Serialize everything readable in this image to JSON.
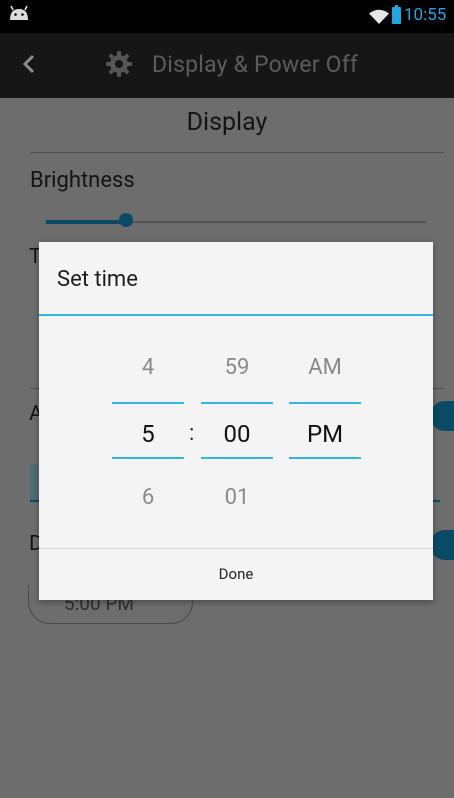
{
  "status_bar": {
    "time": "10:55",
    "icons": [
      "android-icon",
      "wifi-icon",
      "battery-icon"
    ],
    "accent_color": "#1ea7e1"
  },
  "action_bar": {
    "title": "Display & Power Off",
    "icons": [
      "back-chevron-icon",
      "gear-icon"
    ]
  },
  "background": {
    "section_header": "Display",
    "brightness_label": "Brightness",
    "brightness_level": 0.2,
    "partial_letters": [
      "T",
      "A",
      "D"
    ],
    "time_field_value": "5:00 PM"
  },
  "dialog": {
    "title": "Set time",
    "hour": {
      "prev": "4",
      "current": "5",
      "next": "6"
    },
    "separator": ":",
    "minute": {
      "prev": "59",
      "current": "00",
      "next": "01"
    },
    "ampm": {
      "prev": "AM",
      "current": "PM",
      "next": ""
    },
    "done_label": "Done",
    "accent_color": "#33b5e5"
  }
}
